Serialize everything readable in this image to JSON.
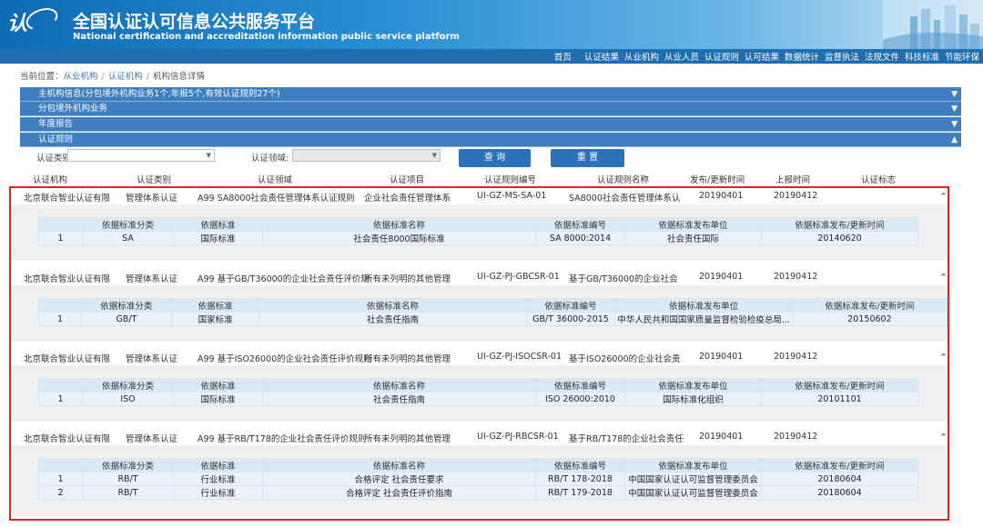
{
  "header": {
    "logo_text": "认",
    "title_cn": "全国认证认可信息公共服务平台",
    "title_en": "National certification and accreditation information public service platform"
  },
  "nav": [
    "首页",
    "认证结果",
    "从业机构",
    "从业人员",
    "认证规则",
    "认可结果",
    "数据统计",
    "监督执法",
    "法规文件",
    "科技标准",
    "节能环保"
  ],
  "breadcrumb": {
    "prefix": "当前位置：",
    "items": [
      "从业机构",
      "认证机构",
      "机构信息详情"
    ],
    "sep": "/"
  },
  "sections": [
    {
      "label": "主机构信息(分包境外机构业务1个,年报5个,有效认证规则27个)",
      "arrow": "▼"
    },
    {
      "label": "分包境外机构业务",
      "arrow": "▼"
    },
    {
      "label": "年度报告",
      "arrow": "▼"
    },
    {
      "label": "认证规则",
      "arrow": "▲"
    }
  ],
  "filters": {
    "type_label": "认证类别:",
    "field_label": "认证领域:",
    "query_btn": "查 询",
    "reset_btn": "重 置"
  },
  "columns": [
    "认证机构",
    "认证类别",
    "认证领域",
    "认证项目",
    "认证规则编号",
    "认证规则名称",
    "发布/更新时间",
    "上报时间",
    "认证标志"
  ],
  "sub_columns": [
    "",
    "依据标准分类",
    "依据标准",
    "依据标准名称",
    "依据标准编号",
    "依据标准发布单位",
    "依据标准发布/更新时间"
  ],
  "records": [
    {
      "org": "北京联合智业认证有限",
      "type": "管理体系认证",
      "field": "A99 SA8000社会责任管理体系认证规则",
      "project": "企业社会责任管理体系",
      "code": "UI-GZ-MS-SA-01",
      "name": "SA8000社会责任管理体系认",
      "pub": "20190401",
      "report": "20190412",
      "caret": "⌃",
      "subs": [
        [
          "1",
          "SA",
          "国际标准",
          "社会责任8000国际标准",
          "SA 8000:2014",
          "社会责任国际",
          "20140620"
        ]
      ]
    },
    {
      "org": "北京联合智业认证有限",
      "type": "管理体系认证",
      "field": "A99 基于GB/T36000的企业社会责任评价规",
      "project": "所有未列明的其他管理",
      "code": "UI-GZ-PJ-GBCSR-01",
      "name": "基于GB/T36000的企业社会",
      "pub": "20190401",
      "report": "20190412",
      "caret": "⌃",
      "subs": [
        [
          "1",
          "GB/T",
          "国家标准",
          "社会责任指南",
          "GB/T 36000-2015",
          "中华人民共和国国家质量监督检验检疫总局...",
          "20150602"
        ]
      ]
    },
    {
      "org": "北京联合智业认证有限",
      "type": "管理体系认证",
      "field": "A99 基于ISO26000的企业社会责任评价规则",
      "project": "所有未列明的其他管理",
      "code": "UI-GZ-PJ-ISOCSR-01",
      "name": "基于ISO26000的企业社会责",
      "pub": "20190401",
      "report": "20190412",
      "caret": "⌃",
      "subs": [
        [
          "1",
          "ISO",
          "国际标准",
          "社会责任指南",
          "ISO 26000:2010",
          "国际标准化组织",
          "20101101"
        ]
      ]
    },
    {
      "org": "北京联合智业认证有限",
      "type": "管理体系认证",
      "field": "A99 基于RB/T178的企业社会责任评价规则",
      "project": "所有未列明的其他管理",
      "code": "UI-GZ-PJ-RBCSR-01",
      "name": "基于RB/T178的企业社会责任",
      "pub": "20190401",
      "report": "20190412",
      "caret": "⌃",
      "subs": [
        [
          "1",
          "RB/T",
          "行业标准",
          "合格评定 社会责任要求",
          "RB/T 178-2018",
          "中国国家认证认可监督管理委员会",
          "20180604"
        ],
        [
          "2",
          "RB/T",
          "行业标准",
          "合格评定 社会责任评价指南",
          "RB/T 179-2018",
          "中国国家认证认可监督管理委员会",
          "20180604"
        ]
      ]
    }
  ]
}
